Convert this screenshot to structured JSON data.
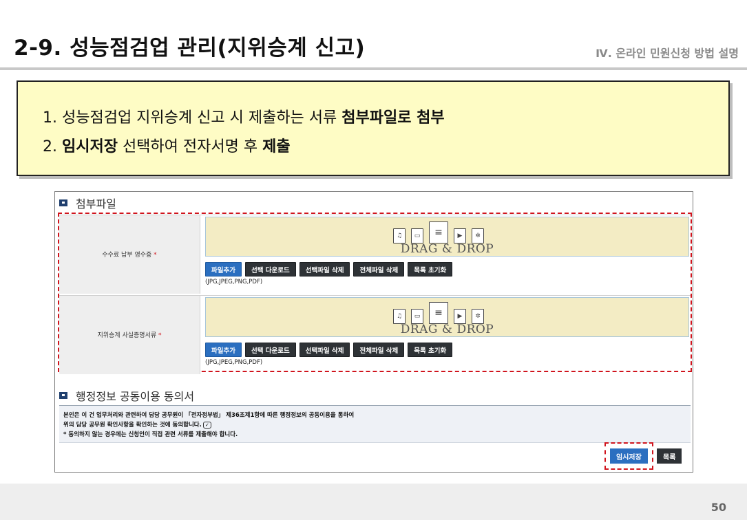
{
  "slide": {
    "title": "2-9. 성능점검업 관리(지위승계 신고)",
    "chapter": "Ⅳ. 온라인 민원신청 방법 설명",
    "page_number": "50"
  },
  "note": {
    "line1_prefix": "1. 성능점검업 지위승계 신고 시 제출하는 서류 ",
    "line1_bold": "첨부파일로 첨부",
    "line2_prefix": "2. ",
    "line2_bold1": "임시저장",
    "line2_middle": " 선택하여 전자서명 후 ",
    "line2_bold2": "제출"
  },
  "attachments": {
    "section_title": "첨부파일",
    "rows": [
      {
        "label": "수수료 납부 영수증",
        "required_mark": "*"
      },
      {
        "label": "지위승계 사실증명서류",
        "required_mark": "*"
      }
    ],
    "drop_text": "DRAG & DROP",
    "icon_names": [
      "audio-file-icon",
      "image-file-icon",
      "document-file-icon",
      "video-file-icon",
      "settings-file-icon"
    ],
    "buttons": {
      "add": "파일추가",
      "download_selected": "선택 다운로드",
      "delete_selected": "선택파일 삭제",
      "delete_all": "전체파일 삭제",
      "reset_list": "목록 초기화"
    },
    "allowed_ext": "(JPG,JPEG,PNG,PDF)"
  },
  "consent": {
    "section_title": "행정정보 공동이용 동의서",
    "line1": "본인은 이 건 업무처리와 관련하여 담당 공무원이 「전자정부법」 제36조제1항에 따른 행정정보의 공동이용을 통하여",
    "line2": "위의 담당 공무원 확인사항을 확인하는 것에 동의합니다.",
    "line3": "* 동의하지 않는 경우에는 신청인이 직접 관련 서류를 제출해야 합니다."
  },
  "actions": {
    "temp_save": "임시저장",
    "list": "목록"
  },
  "colors": {
    "note_bg": "#fefcc5",
    "highlight_red": "#d0141d",
    "primary_blue": "#2b6fc0",
    "dark_button": "#2e3236",
    "drop_bg": "#f3ecc4"
  }
}
